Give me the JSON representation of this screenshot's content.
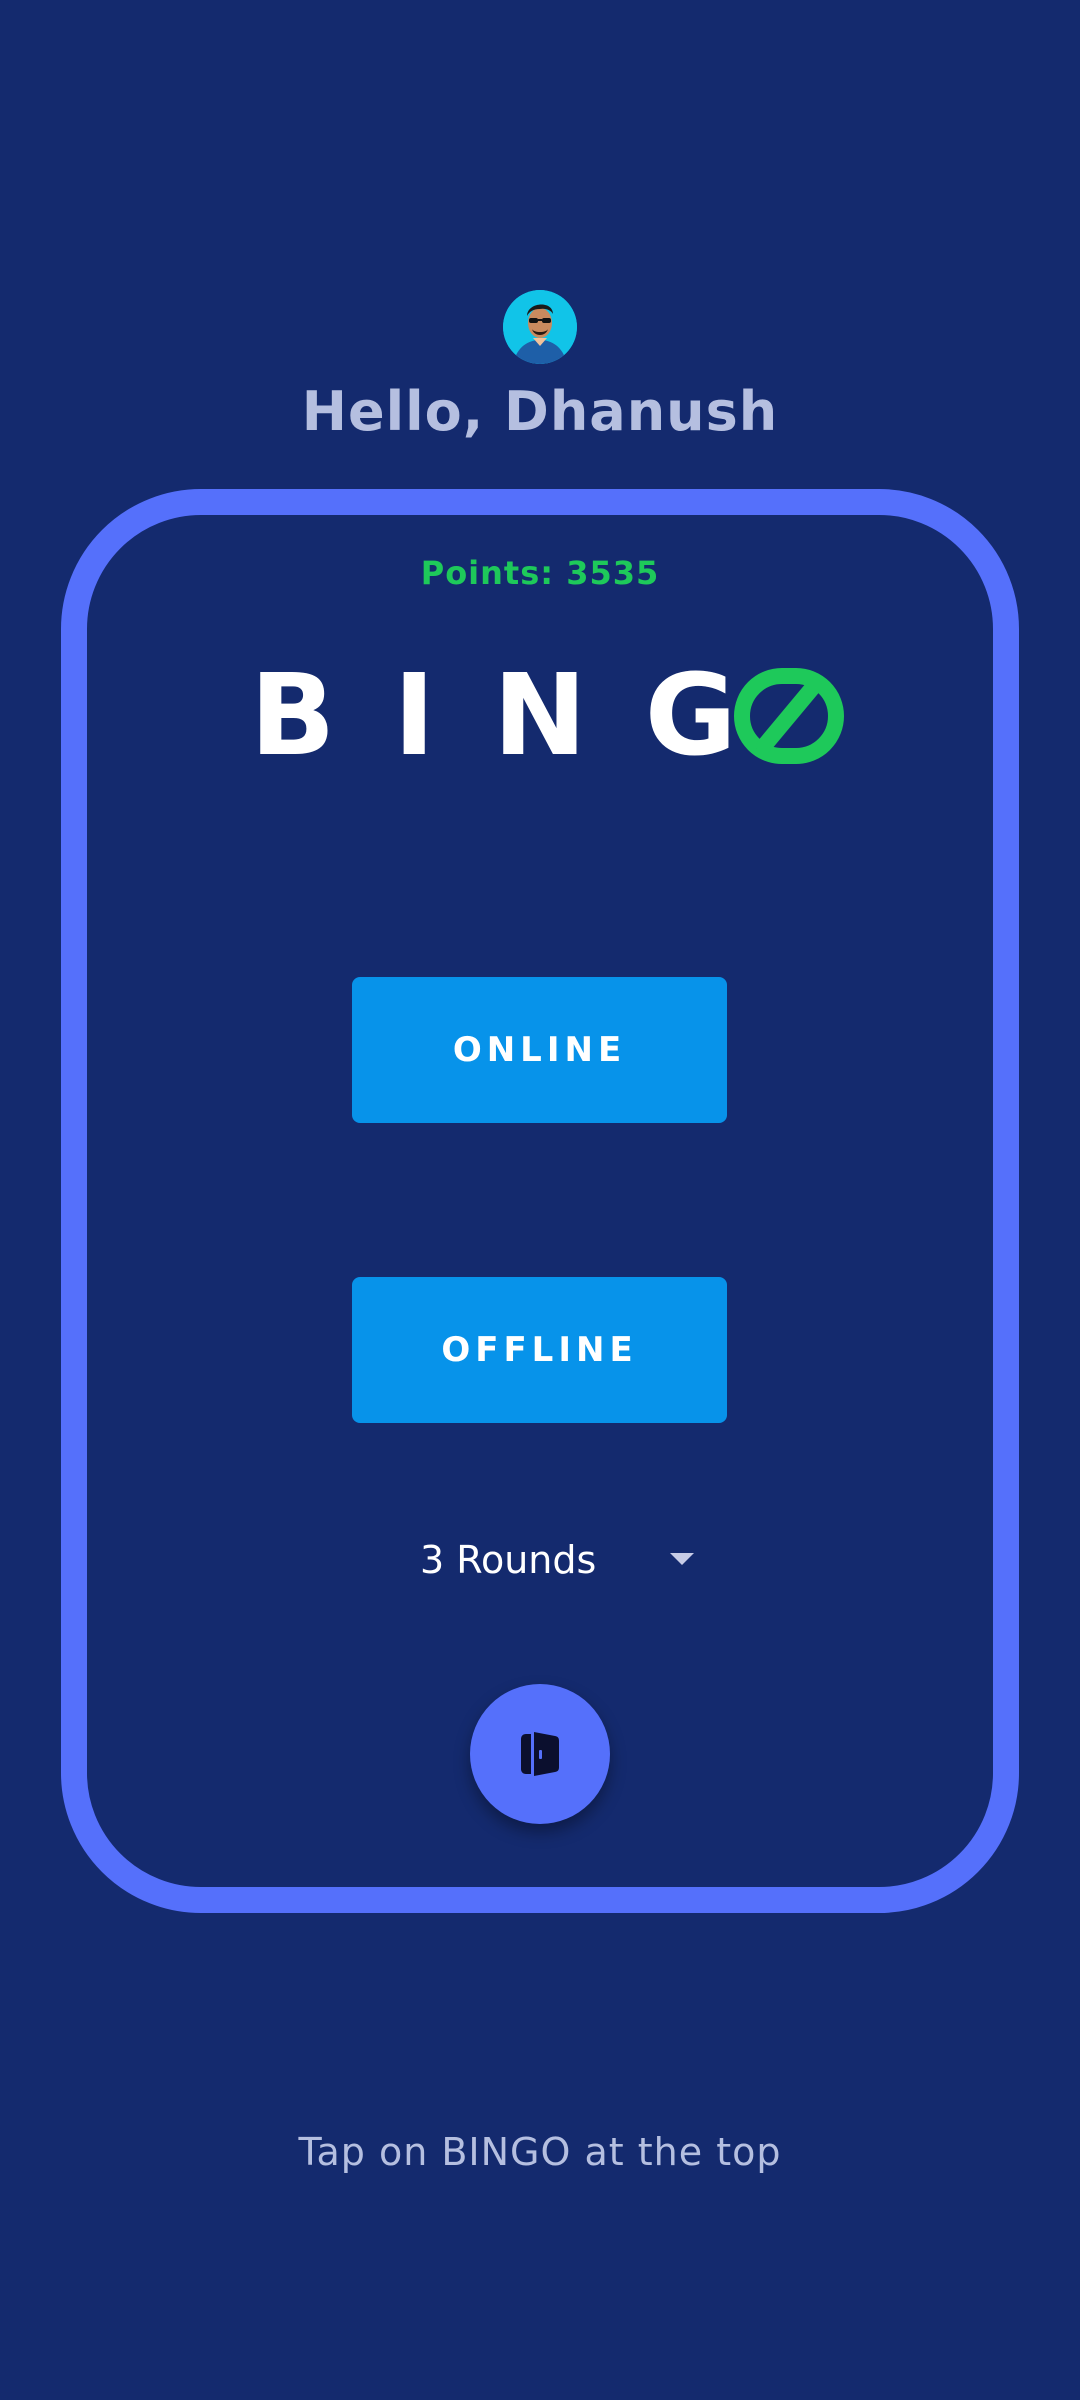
{
  "header": {
    "greeting": "Hello, Dhanush",
    "avatar_icon": "user-avatar"
  },
  "card": {
    "points_label": "Points: 3535",
    "logo_letters": "BING",
    "logo_last_letter": "O",
    "logo_colors": {
      "primary": "#ffffff",
      "accent": "#1ec95a"
    },
    "online_button": "ONLINE",
    "offline_button": "OFFLINE",
    "rounds_select": {
      "selected": "3 Rounds"
    },
    "fab_icon": "door-exit-icon"
  },
  "footer": {
    "hint": "Tap on BINGO at the top"
  },
  "colors": {
    "background": "#142a6e",
    "card_border": "#5570fb",
    "button": "#0793ea",
    "points": "#1ec95a",
    "muted_text": "#b5bfe0"
  }
}
